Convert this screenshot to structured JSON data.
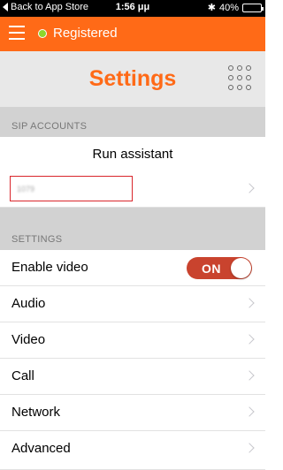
{
  "status_bar": {
    "back_label": "Back to App Store",
    "time": "1:56 μμ",
    "bluetooth": "✱",
    "battery": "40%",
    "battery_level": 0.4
  },
  "top_bar": {
    "status_label": "Registered",
    "status_color": "#8cd62b",
    "accent": "#ff6a17"
  },
  "header": {
    "title": "Settings"
  },
  "sip_accounts": {
    "section_label": "SIP ACCOUNTS",
    "run_assistant_label": "Run assistant",
    "account_text": "1079"
  },
  "settings": {
    "section_label": "SETTINGS",
    "enable_video_label": "Enable video",
    "enable_video_toggle": "ON",
    "items": [
      {
        "label": "Audio"
      },
      {
        "label": "Video"
      },
      {
        "label": "Call"
      },
      {
        "label": "Network"
      },
      {
        "label": "Advanced"
      }
    ]
  },
  "icons": {
    "menu": "hamburger-menu-icon",
    "dialpad": "dialpad-icon",
    "chevron": "chevron-right-icon"
  }
}
